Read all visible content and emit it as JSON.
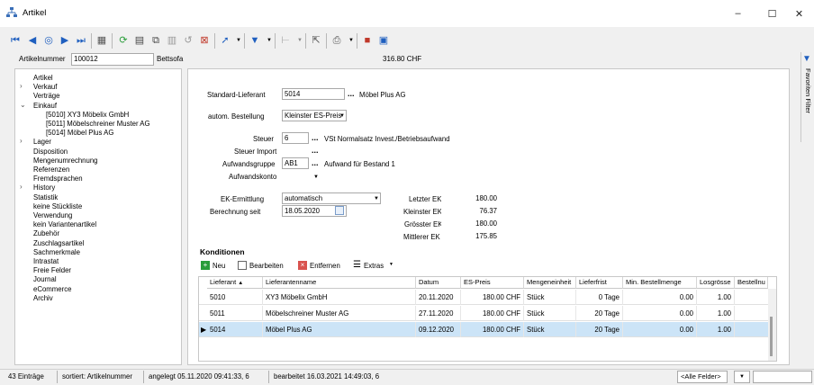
{
  "window": {
    "title": "Artikel",
    "minimize": "–",
    "maximize": "☐",
    "close": "✕"
  },
  "toolbar": {
    "icons": [
      "first-record-icon",
      "previous-record-icon",
      "search-icon",
      "next-record-icon",
      "last-record-icon",
      "table-view-icon",
      "refresh-icon",
      "new-record-icon",
      "copy-record-icon",
      "save-icon",
      "undo-icon",
      "delete-icon",
      "pin-icon",
      "filter-icon",
      "tree-icon",
      "navigate-icon",
      "print-icon",
      "report-icon",
      "form-icon"
    ]
  },
  "header": {
    "label": "Artikelnummer",
    "number": "100012",
    "name": "Bettsofa",
    "price": "316.80 CHF"
  },
  "nav": {
    "items": [
      {
        "label": "Artikel"
      },
      {
        "label": "Verkauf"
      },
      {
        "label": "Verträge"
      },
      {
        "label": "Einkauf"
      },
      {
        "label": "[5010]  XY3 Möbelix GmbH"
      },
      {
        "label": "[5011]  Möbelschreiner Muster AG"
      },
      {
        "label": "[5014]  Möbel Plus AG"
      },
      {
        "label": "Lager"
      },
      {
        "label": "Disposition"
      },
      {
        "label": "Mengenumrechnung"
      },
      {
        "label": "Referenzen"
      },
      {
        "label": "Fremdsprachen"
      },
      {
        "label": "History"
      },
      {
        "label": "Statistik"
      },
      {
        "label": "keine Stückliste"
      },
      {
        "label": "Verwendung"
      },
      {
        "label": "kein Variantenartikel"
      },
      {
        "label": "Zubehör"
      },
      {
        "label": "Zuschlagsartikel"
      },
      {
        "label": "Sachmerkmale"
      },
      {
        "label": "Intrastat"
      },
      {
        "label": "Freie Felder"
      },
      {
        "label": "Journal"
      },
      {
        "label": "eCommerce"
      },
      {
        "label": "Archiv"
      }
    ]
  },
  "form": {
    "standard_lieferant_label": "Standard-Lieferant",
    "standard_lieferant_value": "5014",
    "standard_lieferant_name": "Möbel Plus AG",
    "autom_bestellung_label": "autom. Bestellung",
    "autom_bestellung_value": "Kleinster ES-Preis",
    "steuer_label": "Steuer",
    "steuer_value": "6",
    "steuer_desc": "VSt Normalsatz Invest./Betriebsaufwand",
    "steuer_import_label": "Steuer Import",
    "aufwandsgruppe_label": "Aufwandsgruppe",
    "aufwandsgruppe_value": "AB1",
    "aufwandsgruppe_desc": "Aufwand für Bestand 1",
    "aufwandskonto_label": "Aufwandskonto",
    "ek_ermittlung_label": "EK-Ermittlung",
    "ek_ermittlung_value": "automatisch",
    "berechnung_seit_label": "Berechnung seit",
    "berechnung_seit_value": "18.05.2020",
    "letzter_ek_label": "Letzter EK",
    "letzter_ek_value": "180.00",
    "kleinster_ek_label": "Kleinster EK",
    "kleinster_ek_value": "76.37",
    "groesster_ek_label": "Grösster EK",
    "groesster_ek_value": "180.00",
    "mittlerer_ek_label": "Mittlerer EK",
    "mittlerer_ek_value": "175.85",
    "ellipsis": "..."
  },
  "konditionen": {
    "title": "Konditionen",
    "toolbar": {
      "neu": "Neu",
      "bearbeiten": "Bearbeiten",
      "entfernen": "Entfernen",
      "extras": "Extras"
    },
    "columns": [
      "Lieferant",
      "Lieferantenname",
      "Datum",
      "ES-Preis",
      "Mengeneinheit",
      "Lieferfrist",
      "Min. Bestellmenge",
      "Losgrösse",
      "Bestellnu"
    ],
    "rows": [
      [
        "5010",
        "XY3 Möbelix GmbH",
        "20.11.2020",
        "180.00 CHF",
        "Stück",
        "0 Tage",
        "0.00",
        "1.00"
      ],
      [
        "5011",
        "Möbelschreiner Muster AG",
        "27.11.2020",
        "180.00 CHF",
        "Stück",
        "20 Tage",
        "0.00",
        "1.00"
      ],
      [
        "5014",
        "Möbel Plus AG",
        "09.12.2020",
        "180.00 CHF",
        "Stück",
        "20 Tage",
        "0.00",
        "1.00"
      ]
    ],
    "selected_row": 2
  },
  "status": {
    "entries": "43 Einträge",
    "sorted": "sortiert: Artikelnummer",
    "created": "angelegt 05.11.2020 09:41:33, 6",
    "edited": "bearbeitet 16.03.2021 14:49:03, 6",
    "field_select": "<Alle Felder>"
  },
  "side_panel": {
    "label": "Favoriten Filter"
  }
}
